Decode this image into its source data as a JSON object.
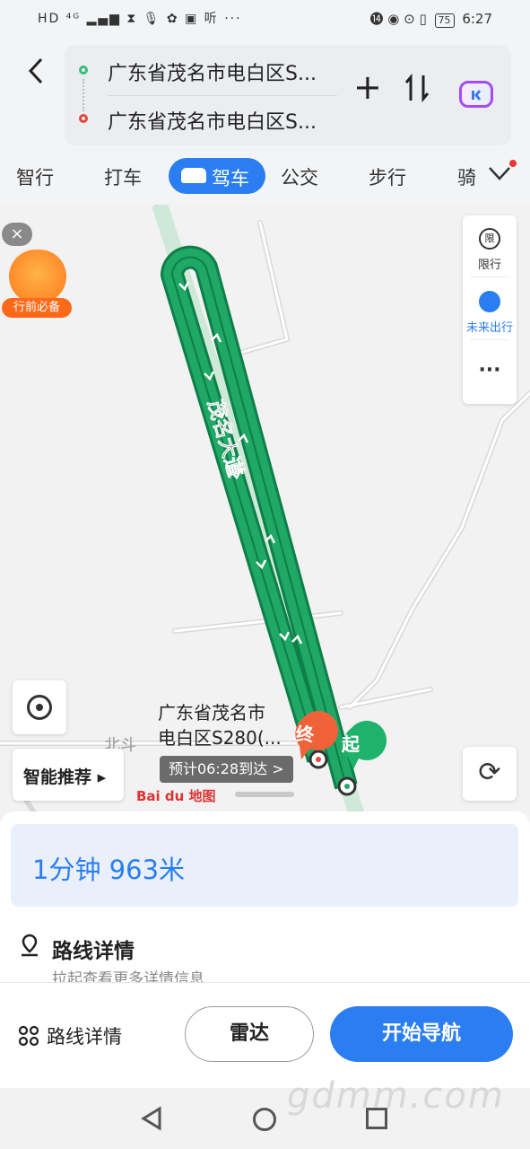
{
  "status_bar": {
    "left_icons": "HD ⁴ᴳ ▂▄▆ ⧗ 🎙 ✿ ▣ 听 ···",
    "right_icons": "⓮ ◉ ⊙ ▯",
    "battery": "75",
    "time": "6:27"
  },
  "header": {
    "back_icon": "back-chevron-icon",
    "origin": "广东省茂名市电白区S...",
    "destination": "广东省茂名市电白区S...",
    "add_icon": "+",
    "swap_icon": "⇅"
  },
  "tabs": {
    "items": [
      "智行",
      "打车",
      "驾车",
      "公交",
      "步行",
      "骑"
    ],
    "active": "驾车"
  },
  "map": {
    "road_name": "茂名大道",
    "side_panel": {
      "limit_label": "限行",
      "limit_icon": "限",
      "future_label": "未来出行",
      "more_label": "···"
    },
    "smart_recommend": "智能推荐 ▸",
    "destination_name_line1": "广东省茂名市",
    "destination_name_line2": "电白区S280(...",
    "end_marker": "终",
    "start_marker": "起",
    "eta": "预计06:28到达 >",
    "place_label": "北斗",
    "logo_text": "Bai du 地图",
    "ad_label": "行前必备",
    "close_icon": "×",
    "colors": {
      "route": "#1fa866",
      "route_border": "#0d7f48",
      "accent": "#2a7ef1"
    }
  },
  "summary": {
    "text": "1分钟  963米"
  },
  "route_detail": {
    "title": "路线详情",
    "subtitle": "拉起查看更多详情信息"
  },
  "actions": {
    "detail_label": "路线详情",
    "radar_label": "雷达",
    "nav_label": "开始导航"
  },
  "watermark": "gdmm.com"
}
